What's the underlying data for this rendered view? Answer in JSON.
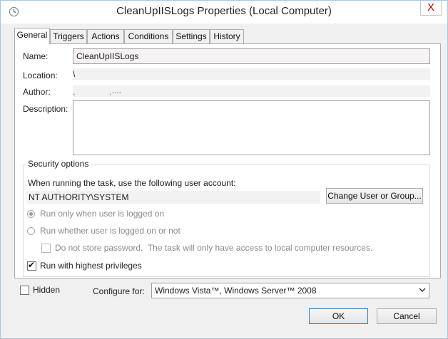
{
  "window": {
    "title": "CleanUpIISLogs Properties (Local Computer)",
    "close_glyph": "X"
  },
  "tabs": [
    {
      "label": "General",
      "active": true
    },
    {
      "label": "Triggers",
      "active": false
    },
    {
      "label": "Actions",
      "active": false
    },
    {
      "label": "Conditions",
      "active": false
    },
    {
      "label": "Settings",
      "active": false
    },
    {
      "label": "History",
      "active": false
    }
  ],
  "general": {
    "name_label": "Name:",
    "name_value": "CleanUpIISLogs",
    "location_label": "Location:",
    "location_value": "\\",
    "author_label": "Author:",
    "author_value": "ˎ              ˌ....",
    "description_label": "Description:",
    "description_value": ""
  },
  "security": {
    "title": "Security options",
    "account_prompt": "When running the task, use the following user account:",
    "account_value": "NT AUTHORITY\\SYSTEM",
    "change_button": "Change User or Group...",
    "radio_logged_on": "Run only when user is logged on",
    "radio_whether": "Run whether user is logged on or not",
    "no_store_password": "Do not store password.  The task will only have access to local computer resources.",
    "highest_privileges": "Run with highest privileges",
    "radio_logged_on_checked": true,
    "highest_privileges_checked": true
  },
  "bottom": {
    "hidden_label": "Hidden",
    "configure_label": "Configure for:",
    "configure_value": "Windows Vista™, Windows Server™ 2008"
  },
  "buttons": {
    "ok": "OK",
    "cancel": "Cancel"
  },
  "colors": {
    "accent": "#1e8ae6",
    "close": "#c00000"
  }
}
